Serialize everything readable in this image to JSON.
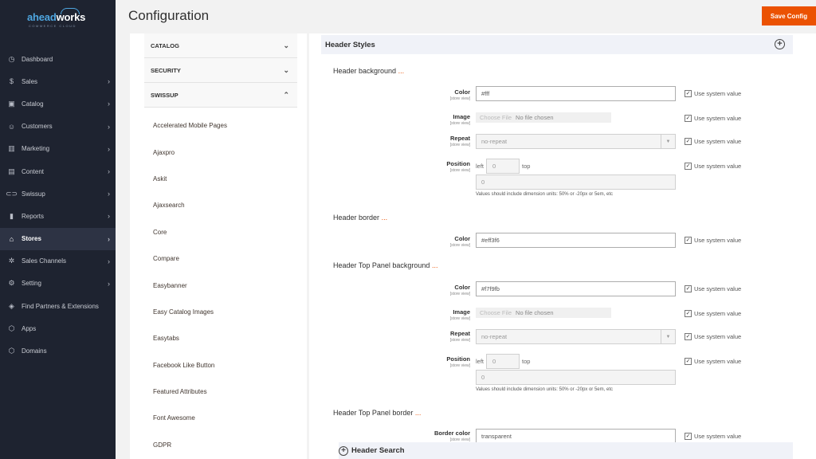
{
  "logo": {
    "brand_a": "ahead",
    "brand_b": "works",
    "tagline": "COMMERCE CLOUD"
  },
  "sidebar": {
    "items": [
      {
        "label": "Dashboard",
        "icon": "dashboard-icon",
        "glyph": "◷",
        "arrow": false,
        "active": false
      },
      {
        "label": "Sales",
        "icon": "dollar-icon",
        "glyph": "$",
        "arrow": true,
        "active": false
      },
      {
        "label": "Catalog",
        "icon": "box-icon",
        "glyph": "▣",
        "arrow": true,
        "active": false
      },
      {
        "label": "Customers",
        "icon": "users-icon",
        "glyph": "☺",
        "arrow": true,
        "active": false
      },
      {
        "label": "Marketing",
        "icon": "megaphone-icon",
        "glyph": "▥",
        "arrow": true,
        "active": false
      },
      {
        "label": "Content",
        "icon": "layout-icon",
        "glyph": "▤",
        "arrow": true,
        "active": false
      },
      {
        "label": "Swissup",
        "icon": "toggle-icon",
        "glyph": "⊂⊃",
        "arrow": true,
        "active": false
      },
      {
        "label": "Reports",
        "icon": "bar-chart-icon",
        "glyph": "▮",
        "arrow": true,
        "active": false
      },
      {
        "label": "Stores",
        "icon": "store-icon",
        "glyph": "⌂",
        "arrow": true,
        "active": true
      },
      {
        "label": "Sales Channels",
        "icon": "network-icon",
        "glyph": "✲",
        "arrow": true,
        "active": false
      },
      {
        "label": "Setting",
        "icon": "gear-icon",
        "glyph": "⚙",
        "arrow": true,
        "active": false
      },
      {
        "label": "Find Partners & Extensions",
        "icon": "cube-icon",
        "glyph": "◈",
        "arrow": false,
        "active": false
      },
      {
        "label": "Apps",
        "icon": "hexagon-icon",
        "glyph": "⬡",
        "arrow": false,
        "active": false
      },
      {
        "label": "Domains",
        "icon": "hexagon-icon",
        "glyph": "⬡",
        "arrow": false,
        "active": false
      }
    ]
  },
  "header": {
    "title": "Configuration",
    "save_label": "Save Config"
  },
  "tabs": {
    "sections": [
      {
        "label": "CATALOG",
        "chevron": "⌄"
      },
      {
        "label": "SECURITY",
        "chevron": "⌄"
      },
      {
        "label": "SWISSUP",
        "chevron": "⌃"
      }
    ],
    "items": [
      "Accelerated Mobile Pages",
      "Ajaxpro",
      "Askit",
      "Ajaxsearch",
      "Core",
      "Compare",
      "Easybanner",
      "Easy Catalog Images",
      "Easytabs",
      "Facebook Like Button",
      "Featured Attributes",
      "Font Awesome",
      "GDPR"
    ]
  },
  "main": {
    "section_title": "Header Styles",
    "store_view": "[store view]",
    "use_system": "Use system value",
    "check_glyph": "✓",
    "groups": {
      "header_background": {
        "title": "Header background",
        "dots": "..."
      },
      "header_border": {
        "title": "Header border",
        "dots": "..."
      },
      "top_panel_background": {
        "title": "Header Top Panel background",
        "dots": "..."
      },
      "top_panel_border": {
        "title": "Header Top Panel border",
        "dots": "..."
      }
    },
    "labels": {
      "color": "Color",
      "image": "Image",
      "repeat": "Repeat",
      "position": "Position",
      "border_color": "Border color"
    },
    "values": {
      "bg_color": "#fff",
      "border_color": "#eff3f6",
      "top_bg_color": "#f7f9fb",
      "top_border_color": "transparent",
      "repeat": "no-repeat",
      "position_x_label": "left",
      "position_x": "0",
      "position_y_label": "top",
      "position_second": "0"
    },
    "file": {
      "button": "Choose File",
      "none": "No file chosen"
    },
    "note": "Values should include dimension units: 50% or -20px or 5em, etc",
    "sub_section": "Header Search"
  }
}
